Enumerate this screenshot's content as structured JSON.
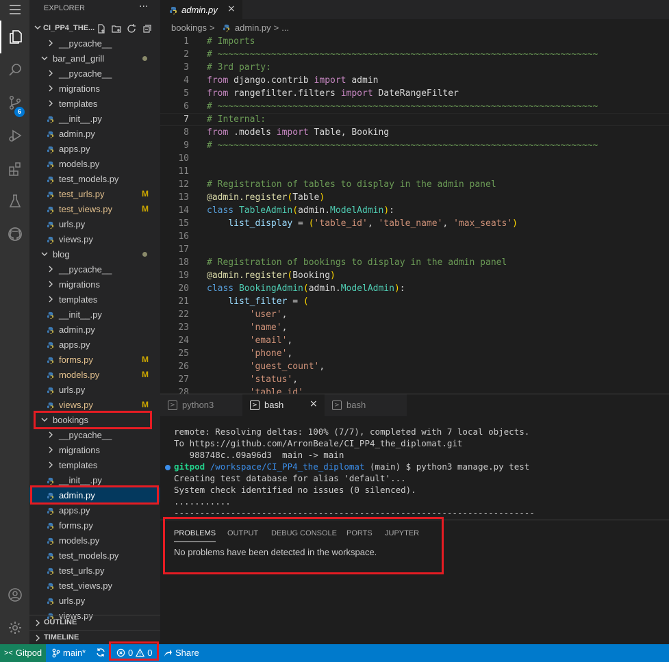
{
  "activity_bar": {
    "badge_count": "6"
  },
  "explorer": {
    "title": "EXPLORER",
    "more": "···",
    "project": "CI_PP4_THE...",
    "tree": [
      {
        "label": "__pycache__",
        "type": "folder",
        "depth": 1
      },
      {
        "label": "bar_and_grill",
        "type": "folder-open",
        "depth": 0,
        "dot": true
      },
      {
        "label": "__pycache__",
        "type": "folder",
        "depth": 1
      },
      {
        "label": "migrations",
        "type": "folder",
        "depth": 1
      },
      {
        "label": "templates",
        "type": "folder",
        "depth": 1
      },
      {
        "label": "__init__.py",
        "type": "py",
        "depth": 1
      },
      {
        "label": "admin.py",
        "type": "py",
        "depth": 1
      },
      {
        "label": "apps.py",
        "type": "py",
        "depth": 1
      },
      {
        "label": "models.py",
        "type": "py",
        "depth": 1
      },
      {
        "label": "test_models.py",
        "type": "py",
        "depth": 1
      },
      {
        "label": "test_urls.py",
        "type": "py",
        "depth": 1,
        "mark": "M"
      },
      {
        "label": "test_views.py",
        "type": "py",
        "depth": 1,
        "mark": "M"
      },
      {
        "label": "urls.py",
        "type": "py",
        "depth": 1
      },
      {
        "label": "views.py",
        "type": "py",
        "depth": 1
      },
      {
        "label": "blog",
        "type": "folder-open",
        "depth": 0,
        "dot": true
      },
      {
        "label": "__pycache__",
        "type": "folder",
        "depth": 1
      },
      {
        "label": "migrations",
        "type": "folder",
        "depth": 1
      },
      {
        "label": "templates",
        "type": "folder",
        "depth": 1
      },
      {
        "label": "__init__.py",
        "type": "py",
        "depth": 1
      },
      {
        "label": "admin.py",
        "type": "py",
        "depth": 1
      },
      {
        "label": "apps.py",
        "type": "py",
        "depth": 1
      },
      {
        "label": "forms.py",
        "type": "py",
        "depth": 1,
        "mark": "M"
      },
      {
        "label": "models.py",
        "type": "py",
        "depth": 1,
        "mark": "M"
      },
      {
        "label": "urls.py",
        "type": "py",
        "depth": 1
      },
      {
        "label": "views.py",
        "type": "py",
        "depth": 1,
        "mark": "M"
      },
      {
        "label": "bookings",
        "type": "folder-open",
        "depth": 0
      },
      {
        "label": "__pycache__",
        "type": "folder",
        "depth": 1
      },
      {
        "label": "migrations",
        "type": "folder",
        "depth": 1
      },
      {
        "label": "templates",
        "type": "folder",
        "depth": 1
      },
      {
        "label": "__init__.py",
        "type": "py",
        "depth": 1
      },
      {
        "label": "admin.py",
        "type": "py",
        "depth": 1,
        "selected": true
      },
      {
        "label": "apps.py",
        "type": "py",
        "depth": 1
      },
      {
        "label": "forms.py",
        "type": "py",
        "depth": 1
      },
      {
        "label": "models.py",
        "type": "py",
        "depth": 1
      },
      {
        "label": "test_models.py",
        "type": "py",
        "depth": 1
      },
      {
        "label": "test_urls.py",
        "type": "py",
        "depth": 1
      },
      {
        "label": "test_views.py",
        "type": "py",
        "depth": 1
      },
      {
        "label": "urls.py",
        "type": "py",
        "depth": 1
      },
      {
        "label": "views.py",
        "type": "py",
        "depth": 1
      }
    ],
    "outline": "OUTLINE",
    "timeline": "TIMELINE"
  },
  "editor": {
    "tab_label": "admin.py",
    "tab_close": "×",
    "breadcrumbs": [
      "bookings",
      ">",
      "admin.py",
      ">",
      "..."
    ],
    "current_line": 7,
    "lines": [
      [
        [
          "cm",
          "# Imports"
        ]
      ],
      [
        [
          "cm",
          "# ~~~~~~~~~~~~~~~~~~~~~~~~~~~~~~~~~~~~~~~~~~~~~~~~~~~~~~~~~~~~~~~~~~~~~~~"
        ]
      ],
      [
        [
          "cm",
          "# 3rd party:"
        ]
      ],
      [
        [
          "kw2",
          "from"
        ],
        [
          "pl",
          " django.contrib "
        ],
        [
          "kw2",
          "import"
        ],
        [
          "pl",
          " admin"
        ]
      ],
      [
        [
          "kw2",
          "from"
        ],
        [
          "pl",
          " rangefilter.filters "
        ],
        [
          "kw2",
          "import"
        ],
        [
          "pl",
          " DateRangeFilter"
        ]
      ],
      [
        [
          "cm",
          "# ~~~~~~~~~~~~~~~~~~~~~~~~~~~~~~~~~~~~~~~~~~~~~~~~~~~~~~~~~~~~~~~~~~~~~~~"
        ]
      ],
      [
        [
          "cm",
          "# Internal:"
        ]
      ],
      [
        [
          "kw2",
          "from"
        ],
        [
          "pl",
          " .models "
        ],
        [
          "kw2",
          "import"
        ],
        [
          "pl",
          " Table, Booking"
        ]
      ],
      [
        [
          "cm",
          "# ~~~~~~~~~~~~~~~~~~~~~~~~~~~~~~~~~~~~~~~~~~~~~~~~~~~~~~~~~~~~~~~~~~~~~~~"
        ]
      ],
      [],
      [],
      [
        [
          "cm",
          "# Registration of tables to display in the admin panel"
        ]
      ],
      [
        [
          "dec",
          "@admin.register"
        ],
        [
          "br",
          "("
        ],
        [
          "pl",
          "Table"
        ],
        [
          "br",
          ")"
        ]
      ],
      [
        [
          "kw",
          "class"
        ],
        [
          "pl",
          " "
        ],
        [
          "cls",
          "TableAdmin"
        ],
        [
          "br",
          "("
        ],
        [
          "pl",
          "admin."
        ],
        [
          "cls",
          "ModelAdmin"
        ],
        [
          "br",
          ")"
        ],
        [
          "pl",
          ":"
        ]
      ],
      [
        [
          "pl",
          "    "
        ],
        [
          "vr",
          "list_display"
        ],
        [
          "pl",
          " = "
        ],
        [
          "br",
          "("
        ],
        [
          "st",
          "'table_id'"
        ],
        [
          "pl",
          ", "
        ],
        [
          "st",
          "'table_name'"
        ],
        [
          "pl",
          ", "
        ],
        [
          "st",
          "'max_seats'"
        ],
        [
          "br",
          ")"
        ]
      ],
      [],
      [],
      [
        [
          "cm",
          "# Registration of bookings to display in the admin panel"
        ]
      ],
      [
        [
          "dec",
          "@admin.register"
        ],
        [
          "br",
          "("
        ],
        [
          "pl",
          "Booking"
        ],
        [
          "br",
          ")"
        ]
      ],
      [
        [
          "kw",
          "class"
        ],
        [
          "pl",
          " "
        ],
        [
          "cls",
          "BookingAdmin"
        ],
        [
          "br",
          "("
        ],
        [
          "pl",
          "admin."
        ],
        [
          "cls",
          "ModelAdmin"
        ],
        [
          "br",
          ")"
        ],
        [
          "pl",
          ":"
        ]
      ],
      [
        [
          "pl",
          "    "
        ],
        [
          "vr",
          "list_filter"
        ],
        [
          "pl",
          " = "
        ],
        [
          "br",
          "("
        ]
      ],
      [
        [
          "pl",
          "        "
        ],
        [
          "st",
          "'user'"
        ],
        [
          "pl",
          ","
        ]
      ],
      [
        [
          "pl",
          "        "
        ],
        [
          "st",
          "'name'"
        ],
        [
          "pl",
          ","
        ]
      ],
      [
        [
          "pl",
          "        "
        ],
        [
          "st",
          "'email'"
        ],
        [
          "pl",
          ","
        ]
      ],
      [
        [
          "pl",
          "        "
        ],
        [
          "st",
          "'phone'"
        ],
        [
          "pl",
          ","
        ]
      ],
      [
        [
          "pl",
          "        "
        ],
        [
          "st",
          "'guest_count'"
        ],
        [
          "pl",
          ","
        ]
      ],
      [
        [
          "pl",
          "        "
        ],
        [
          "st",
          "'status'"
        ],
        [
          "pl",
          ","
        ]
      ],
      [
        [
          "pl",
          "        "
        ],
        [
          "st",
          "'table_id'"
        ],
        [
          "pl",
          ","
        ]
      ]
    ]
  },
  "terminal": {
    "tabs": [
      {
        "label": "python3",
        "active": false
      },
      {
        "label": "bash",
        "active": true,
        "close": "×"
      },
      {
        "label": "bash",
        "active": false
      }
    ],
    "lines": [
      "remote: Resolving deltas: 100% (7/7), completed with 7 local objects.",
      "To https://github.com/ArronBeale/CI_PP4_the_diplomat.git",
      "   988748c..09a96d3  main -> main"
    ],
    "prompt_user": "gitpod",
    "prompt_path": "/workspace/CI_PP4_the_diplomat",
    "prompt_cmd": " (main) $ python3 manage.py test",
    "output": [
      "Creating test database for alias 'default'...",
      "System check identified no issues (0 silenced).",
      "...........",
      "----------------------------------------------------------------------"
    ]
  },
  "problems_panel": {
    "tabs": [
      "PROBLEMS",
      "OUTPUT",
      "DEBUG CONSOLE",
      "PORTS",
      "JUPYTER"
    ],
    "message": "No problems have been detected in the workspace."
  },
  "status_bar": {
    "remote": "Gitpod",
    "branch": "main*",
    "errors": "0",
    "warnings": "0",
    "share": "Share"
  },
  "colors": {
    "accent": "#007acc",
    "highlight_box": "#e51c23",
    "modified": "#e2c08d"
  }
}
